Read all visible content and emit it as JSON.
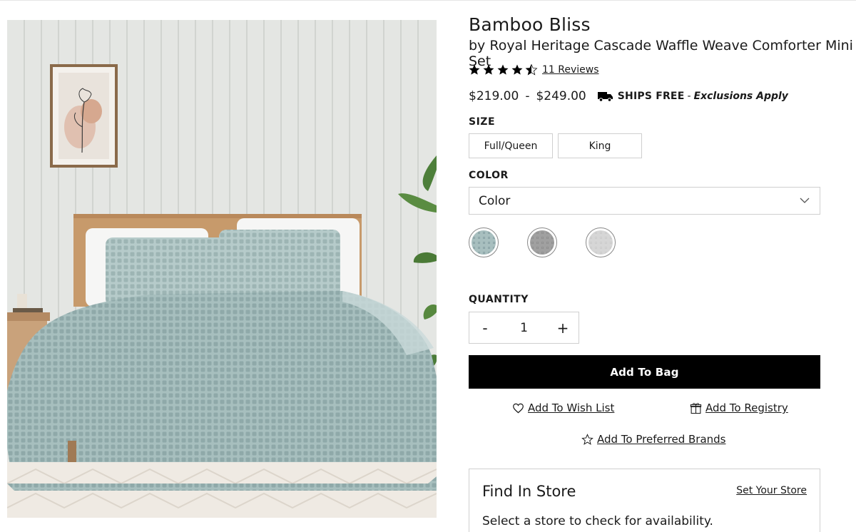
{
  "product": {
    "brand": "Bamboo Bliss",
    "name": "by Royal Heritage Cascade Waffle Weave Comforter Mini Set",
    "rating": 4.5,
    "reviews_label": "11 Reviews"
  },
  "pricing": {
    "low": "$219.00",
    "separator": "-",
    "high": "$249.00",
    "ships_free": "SHIPS FREE",
    "dash": "-",
    "exclusions": "Exclusions Apply"
  },
  "size": {
    "label": "SIZE",
    "options": [
      "Full/Queen",
      "King"
    ]
  },
  "color": {
    "label": "COLOR",
    "selected": "Color",
    "swatch_colors": [
      "#8ea8aa",
      "#939393",
      "#cfcfcf"
    ]
  },
  "quantity": {
    "label": "QUANTITY",
    "minus": "-",
    "value": "1",
    "plus": "+"
  },
  "actions": {
    "add_to_bag": "Add To Bag",
    "wish_list": "Add To Wish List",
    "registry": "Add To Registry",
    "preferred_brands": "Add To Preferred Brands"
  },
  "store": {
    "title": "Find In Store",
    "set_store": "Set Your Store",
    "hint": "Select a store to check for availability."
  },
  "colors": {
    "button_bg": "#000000",
    "button_text": "#ffffff",
    "border": "#cfcfcf",
    "duvet": "#a9c1c0"
  },
  "icons": {
    "star": "star-icon",
    "truck": "truck-icon",
    "chevron": "chevron-down-icon",
    "heart": "heart-icon",
    "gift": "gift-icon",
    "star_outline": "star-outline-icon"
  }
}
